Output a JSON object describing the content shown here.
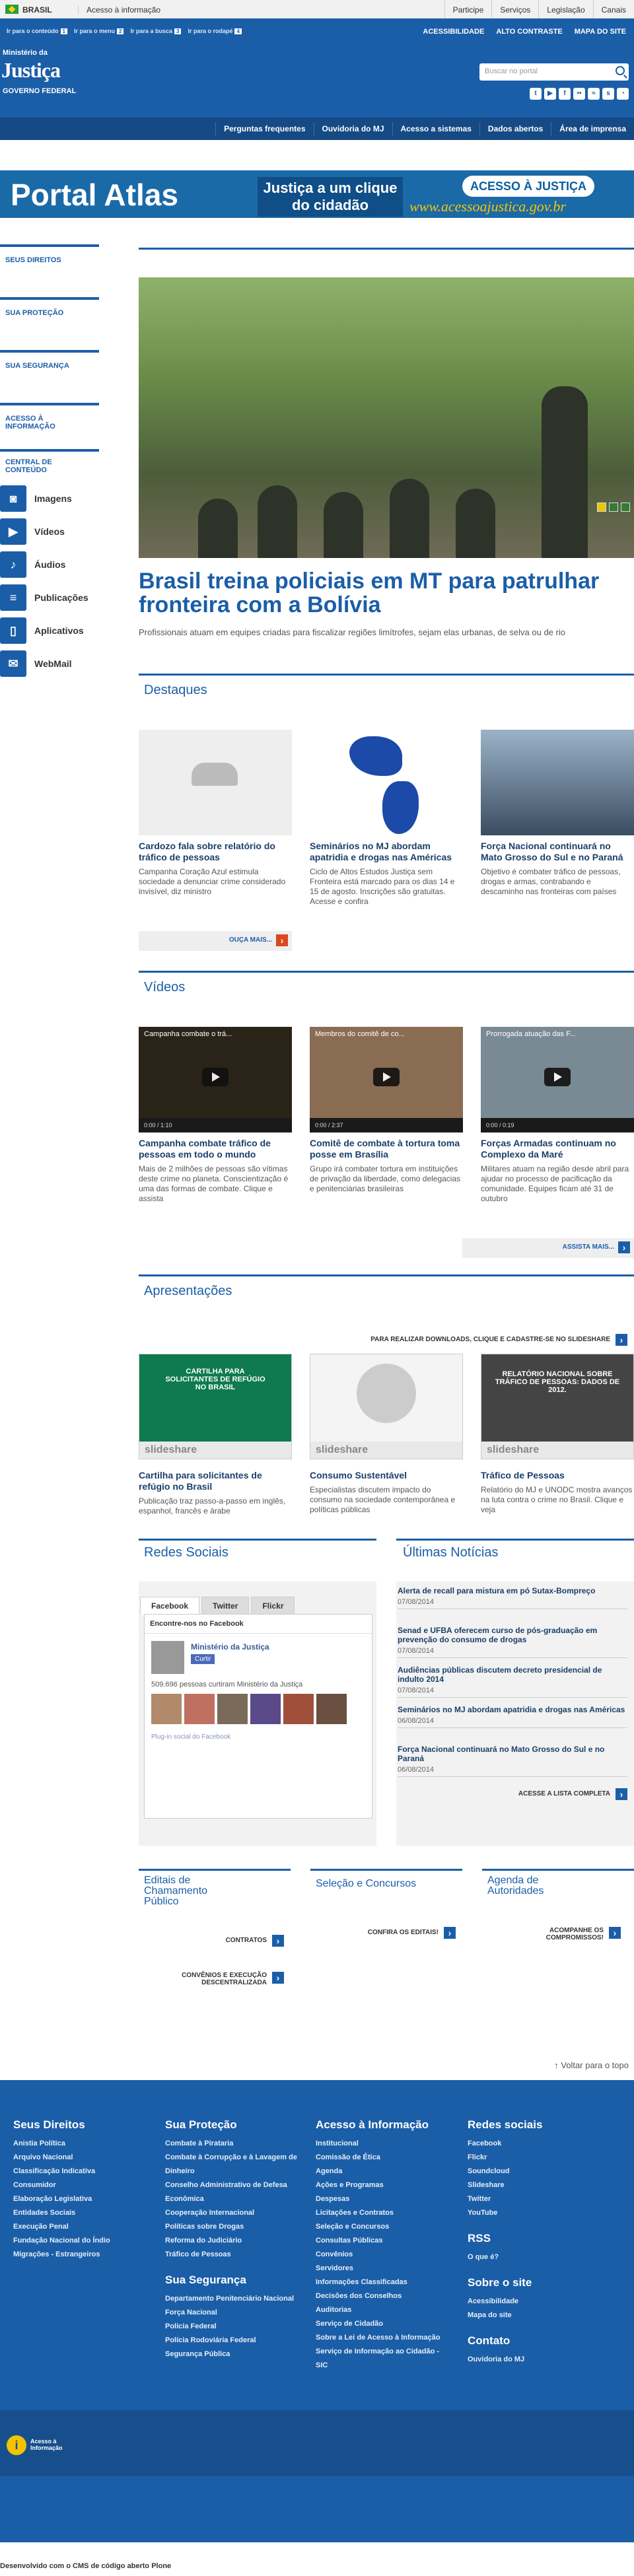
{
  "govbar": {
    "brasil": "BRASIL",
    "acesso": "Acesso à informação",
    "links": [
      "Participe",
      "Serviços",
      "Legislação",
      "Canais"
    ]
  },
  "header": {
    "acc_links": [
      "Ir para o conteúdo 1",
      "Ir para o menu 2",
      "Ir para a busca 3",
      "Ir para o rodapé 4"
    ],
    "acc_keys": [
      "1",
      "2",
      "3",
      "4"
    ],
    "acc_labels": [
      "Ir para o conteúdo",
      "Ir para o menu",
      "Ir para a busca",
      "Ir para o rodapé"
    ],
    "right_links": [
      "ACESSIBILIDADE",
      "ALTO CONTRASTE",
      "MAPA DO SITE"
    ],
    "ministry": "Ministério da",
    "title": "Justiça",
    "gov": "GOVERNO FEDERAL",
    "search_placeholder": "Buscar no portal"
  },
  "services": [
    "Perguntas frequentes",
    "Ouvidoria do MJ",
    "Acesso a sistemas",
    "Dados abertos",
    "Área de imprensa"
  ],
  "banner": {
    "portal": "Portal Atlas",
    "mid": "Justiça a um clique do cidadão",
    "logo": "ACESSO À JUSTIÇA",
    "url": "www.acessoajustica.gov.br"
  },
  "sidebar": {
    "blocks": [
      "SEUS DIREITOS",
      "SUA PROTEÇÃO",
      "SUA SEGURANÇA",
      "ACESSO À INFORMAÇÃO",
      "CENTRAL DE CONTEÚDO"
    ],
    "items": [
      {
        "label": "Imagens",
        "icon": "camera-icon"
      },
      {
        "label": "Vídeos",
        "icon": "video-icon"
      },
      {
        "label": "Áudios",
        "icon": "audio-icon"
      },
      {
        "label": "Publicações",
        "icon": "document-icon"
      },
      {
        "label": "Aplicativos",
        "icon": "mobile-icon"
      },
      {
        "label": "WebMail",
        "icon": "mail-icon"
      }
    ]
  },
  "hero": {
    "title": "Brasil treina policiais em MT para patrulhar fronteira com a Bolívia",
    "subtitle": "Profissionais atuam em equipes criadas para fiscalizar regiões limítrofes, sejam elas urbanas, de selva ou de rio"
  },
  "destaques": {
    "title": "Destaques",
    "cards": [
      {
        "title": "Cardozo fala sobre relatório do tráfico de pessoas",
        "desc": "Campanha Coração Azul estimula sociedade a denunciar crime considerado invisível, diz ministro"
      },
      {
        "title": "Seminários no MJ abordam apatridia e drogas nas Américas",
        "desc": "Ciclo de Altos Estudos Justiça sem Fronteira está marcado para os dias 14 e 15 de agosto. Inscrições são gratuitas. Acesse e confira"
      },
      {
        "title": "Força Nacional continuará no Mato Grosso do Sul e no Paraná",
        "desc": "Objetivo é combater tráfico de pessoas, drogas e armas, contrabando e descaminho nas fronteiras com países"
      }
    ],
    "more": "OUÇA MAIS..."
  },
  "videos": {
    "title": "Vídeos",
    "cards": [
      {
        "thumb": "Campanha combate o trá...",
        "time": "0:00 / 1:10",
        "title": "Campanha combate tráfico de pessoas em todo o mundo",
        "desc": "Mais de 2 milhões de pessoas são vítimas deste crime no planeta. Conscientização é uma das formas de combate. Clique e assista"
      },
      {
        "thumb": "Membros do comitê de co...",
        "time": "0:00 / 2:37",
        "title": "Comitê de combate à tortura toma posse em Brasília",
        "desc": "Grupo irá combater tortura em instituições de privação da liberdade, como delegacias e penitenciárias brasileiras"
      },
      {
        "thumb": "Prorrogada atuação das F...",
        "time": "0:00 / 0:19",
        "title": "Forças Armadas continuam no Complexo da Maré",
        "desc": "Militares atuam na região desde abril para ajudar no processo de pacificação da comunidade. Equipes ficam até 31 de outubro"
      }
    ],
    "more": "ASSISTA MAIS..."
  },
  "apresentacoes": {
    "title": "Apresentações",
    "download": "PARA REALIZAR DOWNLOADS, CLIQUE E CADASTRE-SE NO SLIDESHARE",
    "cards": [
      {
        "slide": "CARTILHA PARA SOLICITANTES DE REFÚGIO NO BRASIL",
        "title": "Cartilha para solicitantes de refúgio no Brasil",
        "desc": "Publicação traz passo-a-passo em inglês, espanhol, francês e árabe"
      },
      {
        "slide": "",
        "title": "Consumo Sustentável",
        "desc": "Especialistas discutem impacto do consumo na sociedade contemporânea e políticas públicas"
      },
      {
        "slide": "RELATÓRIO NACIONAL SOBRE TRÁFICO DE PESSOAS: DADOS DE 2012.",
        "title": "Tráfico de Pessoas",
        "desc": "Relatório do MJ e UNODC mostra avanços na luta contra o crime no Brasil. Clique e veja"
      }
    ],
    "brand": "slideshare"
  },
  "redes": {
    "title": "Redes Sociais",
    "tabs": [
      "Facebook",
      "Twitter",
      "Flickr"
    ],
    "fb_title": "Encontre-nos no Facebook",
    "page": "Ministério da Justiça",
    "curtir": "Curtir",
    "count": "509.696 pessoas curtiram Ministério da Justiça",
    "plugin": "Plug-in social do Facebook"
  },
  "noticias": {
    "title": "Últimas Notícias",
    "items": [
      {
        "t": "Alerta de recall para mistura em pó Sutax-Bompreço",
        "d": "07/08/2014"
      },
      {
        "t": "Senad e UFBA oferecem curso de pós-graduação em prevenção do consumo de drogas",
        "d": "07/08/2014"
      },
      {
        "t": "Audiências públicas discutem decreto presidencial de indulto 2014",
        "d": "07/08/2014"
      },
      {
        "t": "Seminários no MJ abordam apatridia e drogas nas Américas",
        "d": "06/08/2014"
      },
      {
        "t": "Força Nacional continuará no Mato Grosso do Sul e no Paraná",
        "d": "06/08/2014"
      }
    ],
    "more": "ACESSE A LISTA COMPLETA"
  },
  "bottom": {
    "editais": "Editais de Chamamento Público",
    "contratos": "CONTRATOS",
    "convenios": "CONVÊNIOS E EXECUÇÃO DESCENTRALIZADA",
    "selecao": "Seleção e Concursos",
    "confira": "CONFIRA OS EDITAIS!",
    "agenda": "Agenda de Autoridades",
    "acompanhe": "ACOMPANHE OS COMPROMISSOS!"
  },
  "voltar": "Voltar para o topo",
  "footer": {
    "cols": [
      {
        "title": "Seus Direitos",
        "items": [
          "Anistia Política",
          "Arquivo Nacional",
          "Classificação Indicativa",
          "Consumidor",
          "Elaboração Legislativa",
          "Entidades Sociais",
          "Execução Penal",
          "Fundação Nacional do Índio",
          "Migrações - Estrangeiros"
        ]
      },
      {
        "title": "Sua Proteção",
        "items": [
          "Combate à Pirataria",
          "Combate à Corrupção e à Lavagem de Dinheiro",
          "Conselho Administrativo de Defesa Econômica",
          "Cooperação Internacional",
          "Políticas sobre Drogas",
          "Reforma do Judiciário",
          "Tráfico de Pessoas"
        ],
        "title2": "Sua Segurança",
        "items2": [
          "Departamento Penitenciário Nacional",
          "Força Nacional",
          "Polícia Federal",
          "Polícia Rodoviária Federal",
          "Segurança Pública"
        ]
      },
      {
        "title": "Acesso à Informação",
        "items": [
          "Institucional",
          "Comissão de Ética",
          "Agenda",
          "Ações e Programas",
          "Despesas",
          "Licitações e Contratos",
          "Seleção e Concursos",
          "Consultas Públicas",
          "Convênios",
          "Servidores",
          "Informações Classificadas",
          "Decisões dos Conselhos",
          "Auditorias",
          "Serviço de Cidadão",
          "Sobre a Lei de Acesso à Informação",
          "Serviço de Informação ao Cidadão - SIC"
        ]
      },
      {
        "title": "Redes sociais",
        "items": [
          "Facebook",
          "Flickr",
          "Soundcloud",
          "Slideshare",
          "Twitter",
          "YouTube"
        ],
        "title2": "RSS",
        "items2": [
          "O que é?"
        ],
        "title3": "Sobre o site",
        "items3": [
          "Acessibilidade",
          "Mapa do site"
        ],
        "title4": "Contato",
        "items4": [
          "Ouvidoria do MJ"
        ]
      }
    ],
    "acesso_logo": "Acesso à Informação"
  },
  "credits": "Desenvolvido com o CMS de código aberto Plone"
}
